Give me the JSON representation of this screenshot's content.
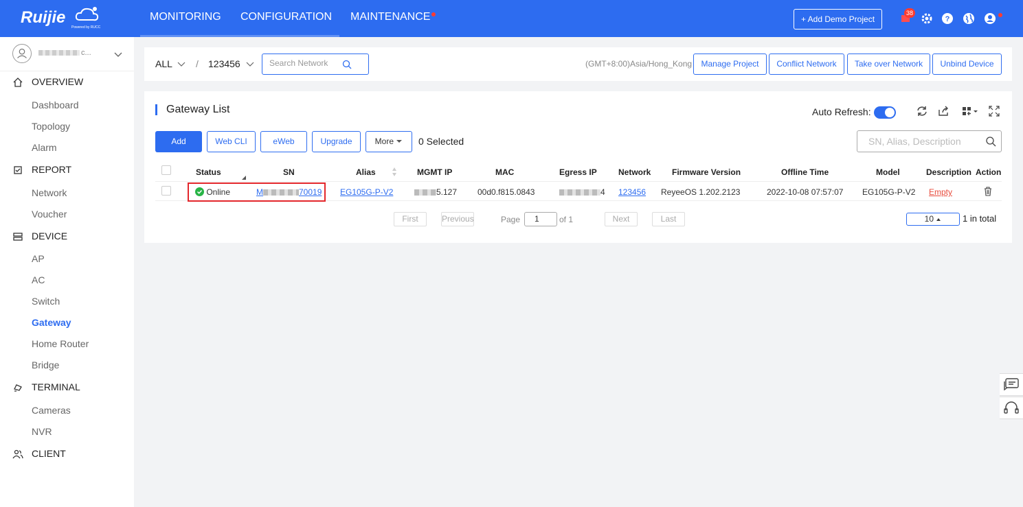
{
  "brand": {
    "logo_text": "Ruijie",
    "powered_by": "Powered by RUCC"
  },
  "nav": {
    "monitoring": "MONITORING",
    "configuration": "CONFIGURATION",
    "maintenance": "MAINTENANCE"
  },
  "topbar": {
    "add_demo_label": "+ Add Demo Project",
    "notification_count": "38"
  },
  "sidebar": {
    "user_suffix": "c...",
    "overview": "OVERVIEW",
    "overview_items": [
      "Dashboard",
      "Topology",
      "Alarm"
    ],
    "report": "REPORT",
    "report_items": [
      "Network",
      "Voucher"
    ],
    "device": "DEVICE",
    "device_items": [
      "AP",
      "AC",
      "Switch",
      "Gateway",
      "Home Router",
      "Bridge"
    ],
    "terminal": "TERMINAL",
    "terminal_items": [
      "Cameras",
      "NVR"
    ],
    "client": "CLIENT",
    "active_item": "Gateway"
  },
  "filter": {
    "scope": "ALL",
    "separator": "/",
    "network": "123456",
    "search_placeholder": "Search Network",
    "timezone": "(GMT+8:00)Asia/Hong_Kong",
    "buttons": [
      "Manage Project",
      "Conflict Network",
      "Take over Network",
      "Unbind Device"
    ]
  },
  "panel": {
    "title": "Gateway List",
    "auto_refresh_label": "Auto Refresh:",
    "auto_refresh_on": true,
    "actions": {
      "add": "Add",
      "web_cli": "Web CLI",
      "eweb": "eWeb",
      "upgrade": "Upgrade",
      "more": "More"
    },
    "selected_text": "0 Selected",
    "search_placeholder": "SN, Alias, Description"
  },
  "table": {
    "columns": [
      "Status",
      "SN",
      "Alias",
      "MGMT IP",
      "MAC",
      "Egress IP",
      "Network",
      "Firmware Version",
      "Offline Time",
      "Model",
      "Description",
      "Action"
    ],
    "rows": [
      {
        "status": "Online",
        "sn_prefix": "M",
        "sn_suffix": "70019",
        "alias": "EG105G-P-V2",
        "mgmt_ip_suffix": "5.127",
        "mac": "00d0.f815.0843",
        "egress_ip_suffix": "4",
        "network": "123456",
        "firmware": "ReyeeOS 1.202.2123",
        "offline_time": "2022-10-08 07:57:07",
        "model": "EG105G-P-V2",
        "description": "Empty"
      }
    ]
  },
  "pagination": {
    "first": "First",
    "previous": "Previous",
    "page_label": "Page",
    "page_value": "1",
    "of_label": "of 1",
    "next": "Next",
    "last": "Last",
    "page_size": "10",
    "total": "1 in total"
  },
  "colors": {
    "primary": "#2d6cf0",
    "online": "#28b446",
    "alert": "#e3262b"
  }
}
